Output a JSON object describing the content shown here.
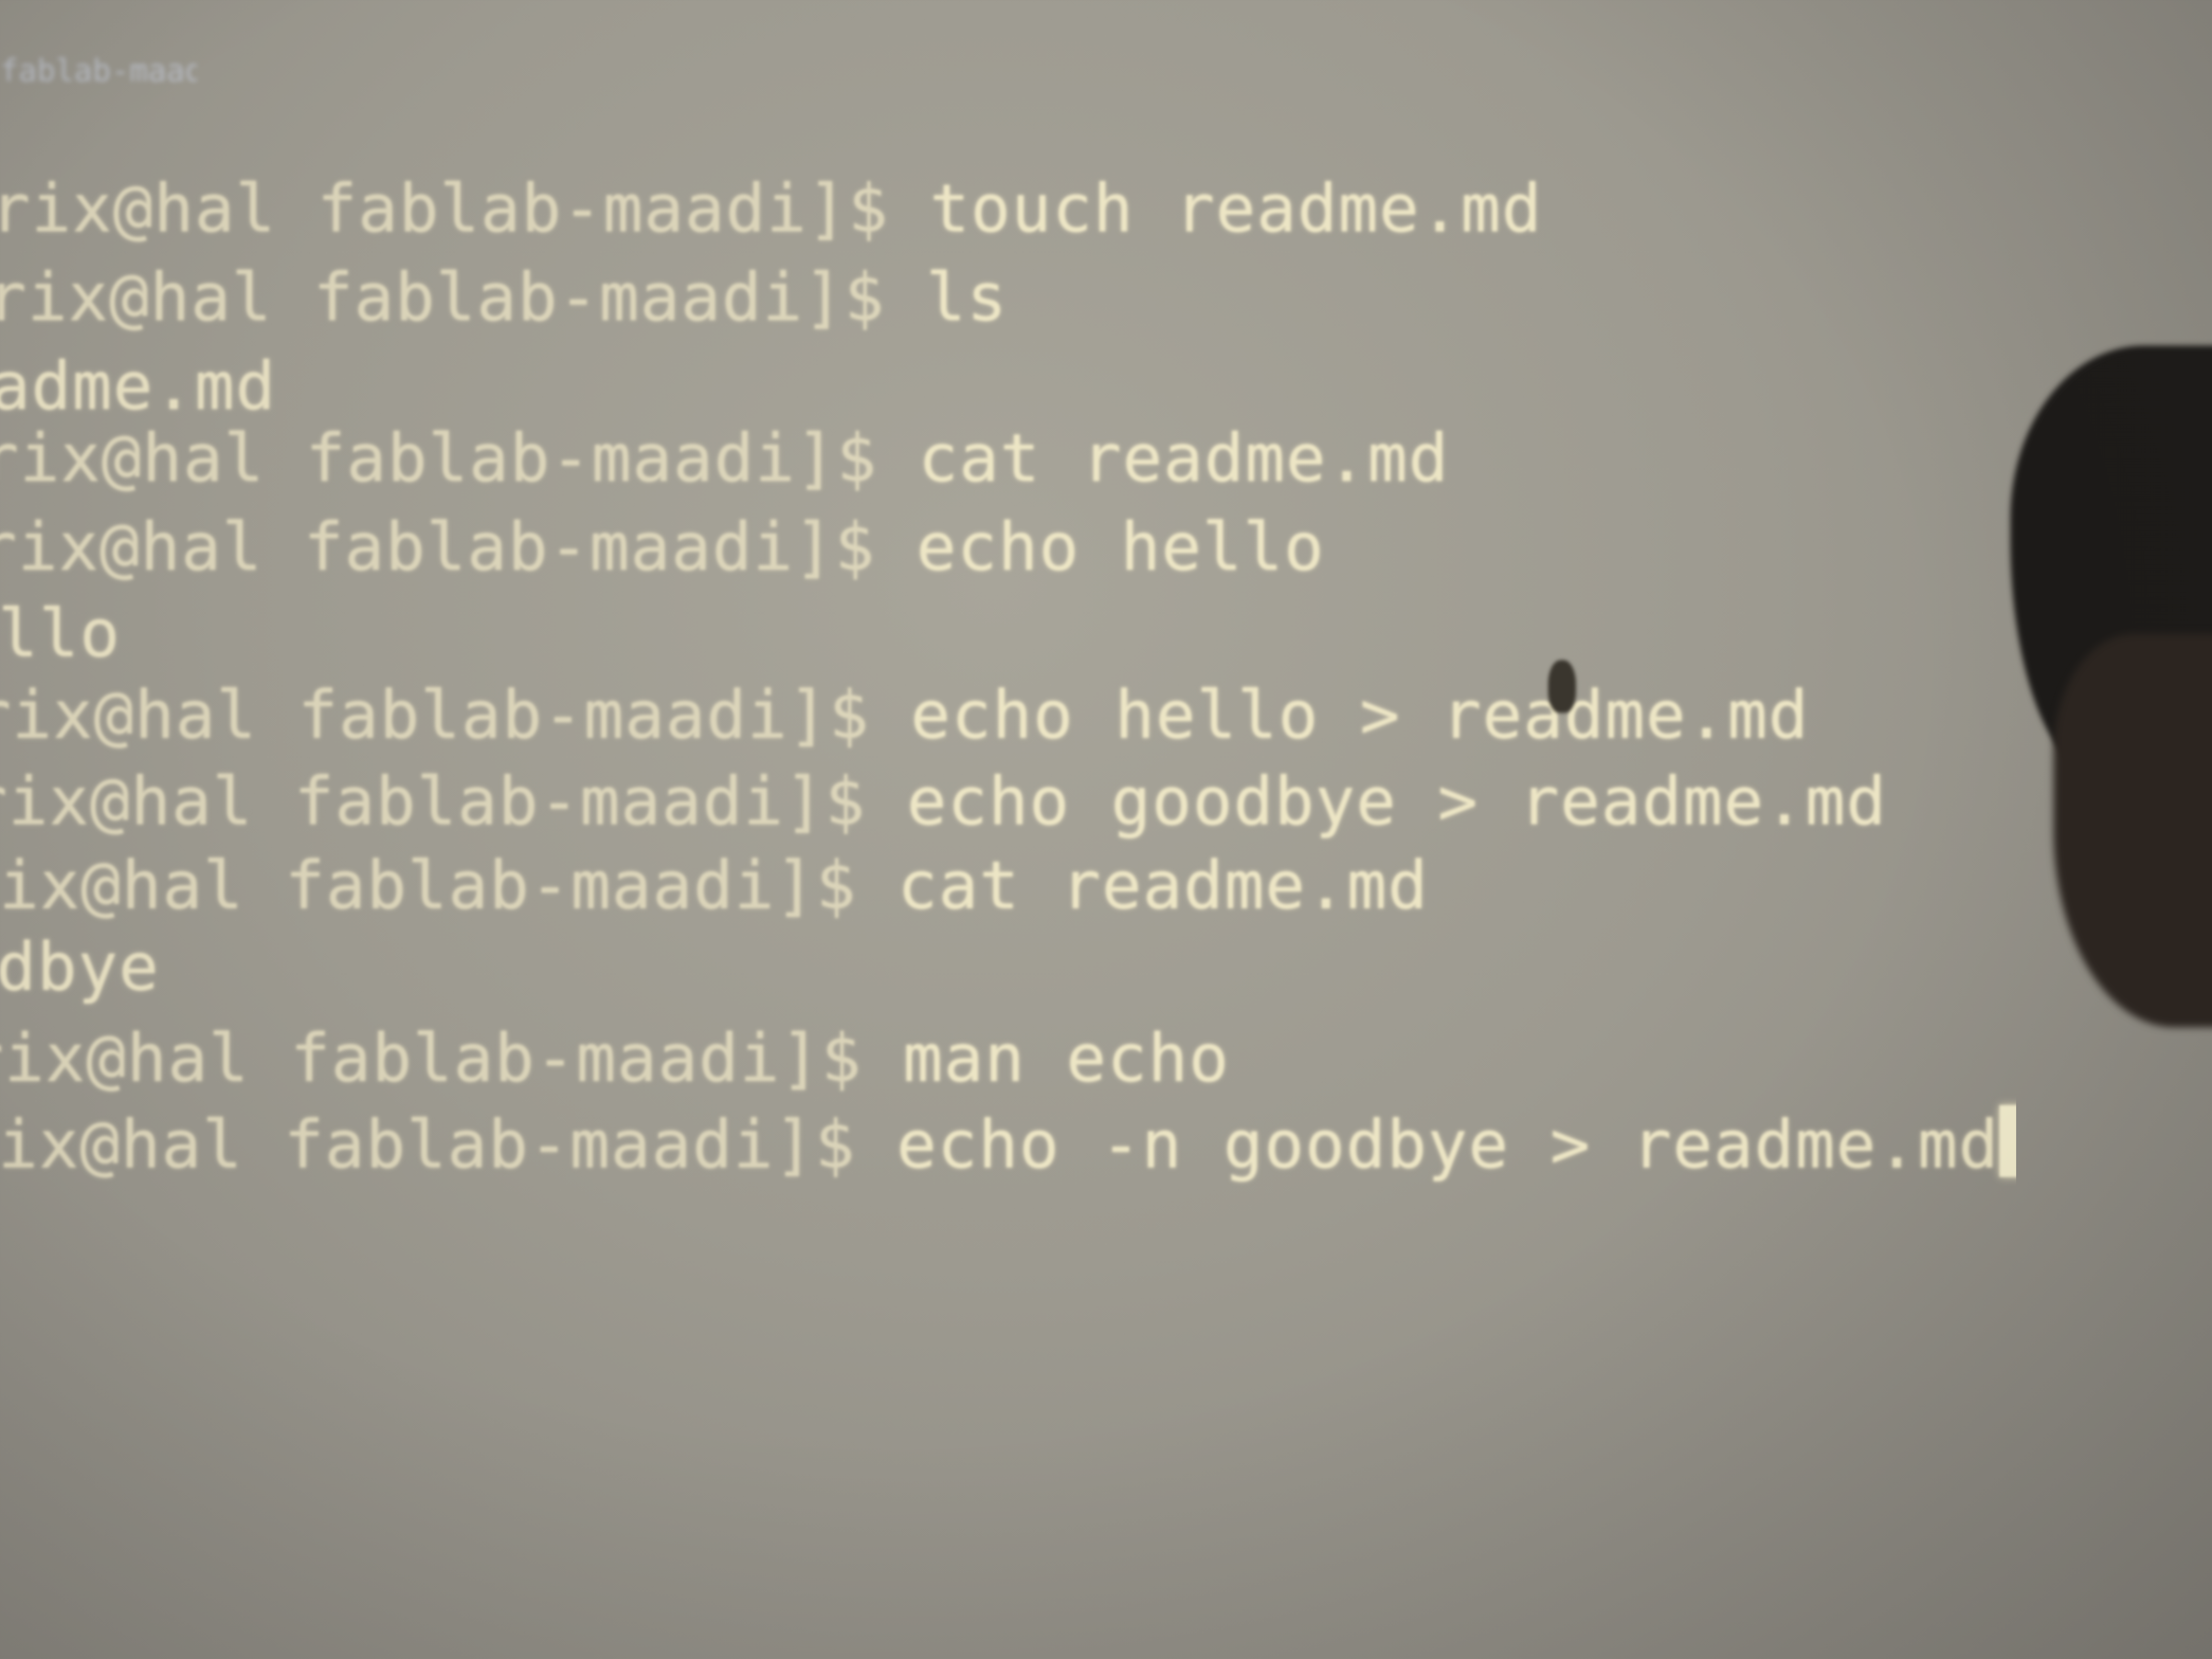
{
  "terminal": {
    "tab_title": "fablab-maadi",
    "lines": [
      {
        "prompt": "rix@hal fablab-maadi]$ ",
        "command": "touch readme.md"
      },
      {
        "prompt": "rix@hal fablab-maadi]$ ",
        "command": "ls"
      },
      {
        "output": "adme.md"
      },
      {
        "prompt": "rix@hal fablab-maadi]$ ",
        "command": "cat readme.md"
      },
      {
        "prompt": "rix@hal fablab-maadi]$ ",
        "command": "echo hello"
      },
      {
        "output": "llo"
      },
      {
        "prompt": "rix@hal fablab-maadi]$ ",
        "command": "echo hello > readme.md"
      },
      {
        "prompt": "rix@hal fablab-maadi]$ ",
        "command": "echo goodbye > readme.md"
      },
      {
        "prompt": "ix@hal fablab-maadi]$ ",
        "command": "cat readme.md"
      },
      {
        "output": "dbye"
      },
      {
        "prompt": "rix@hal fablab-maadi]$ ",
        "command": "man echo"
      },
      {
        "prompt": "ix@hal fablab-maadi]$ ",
        "command": "echo -n goodbye > readme.md"
      }
    ]
  }
}
